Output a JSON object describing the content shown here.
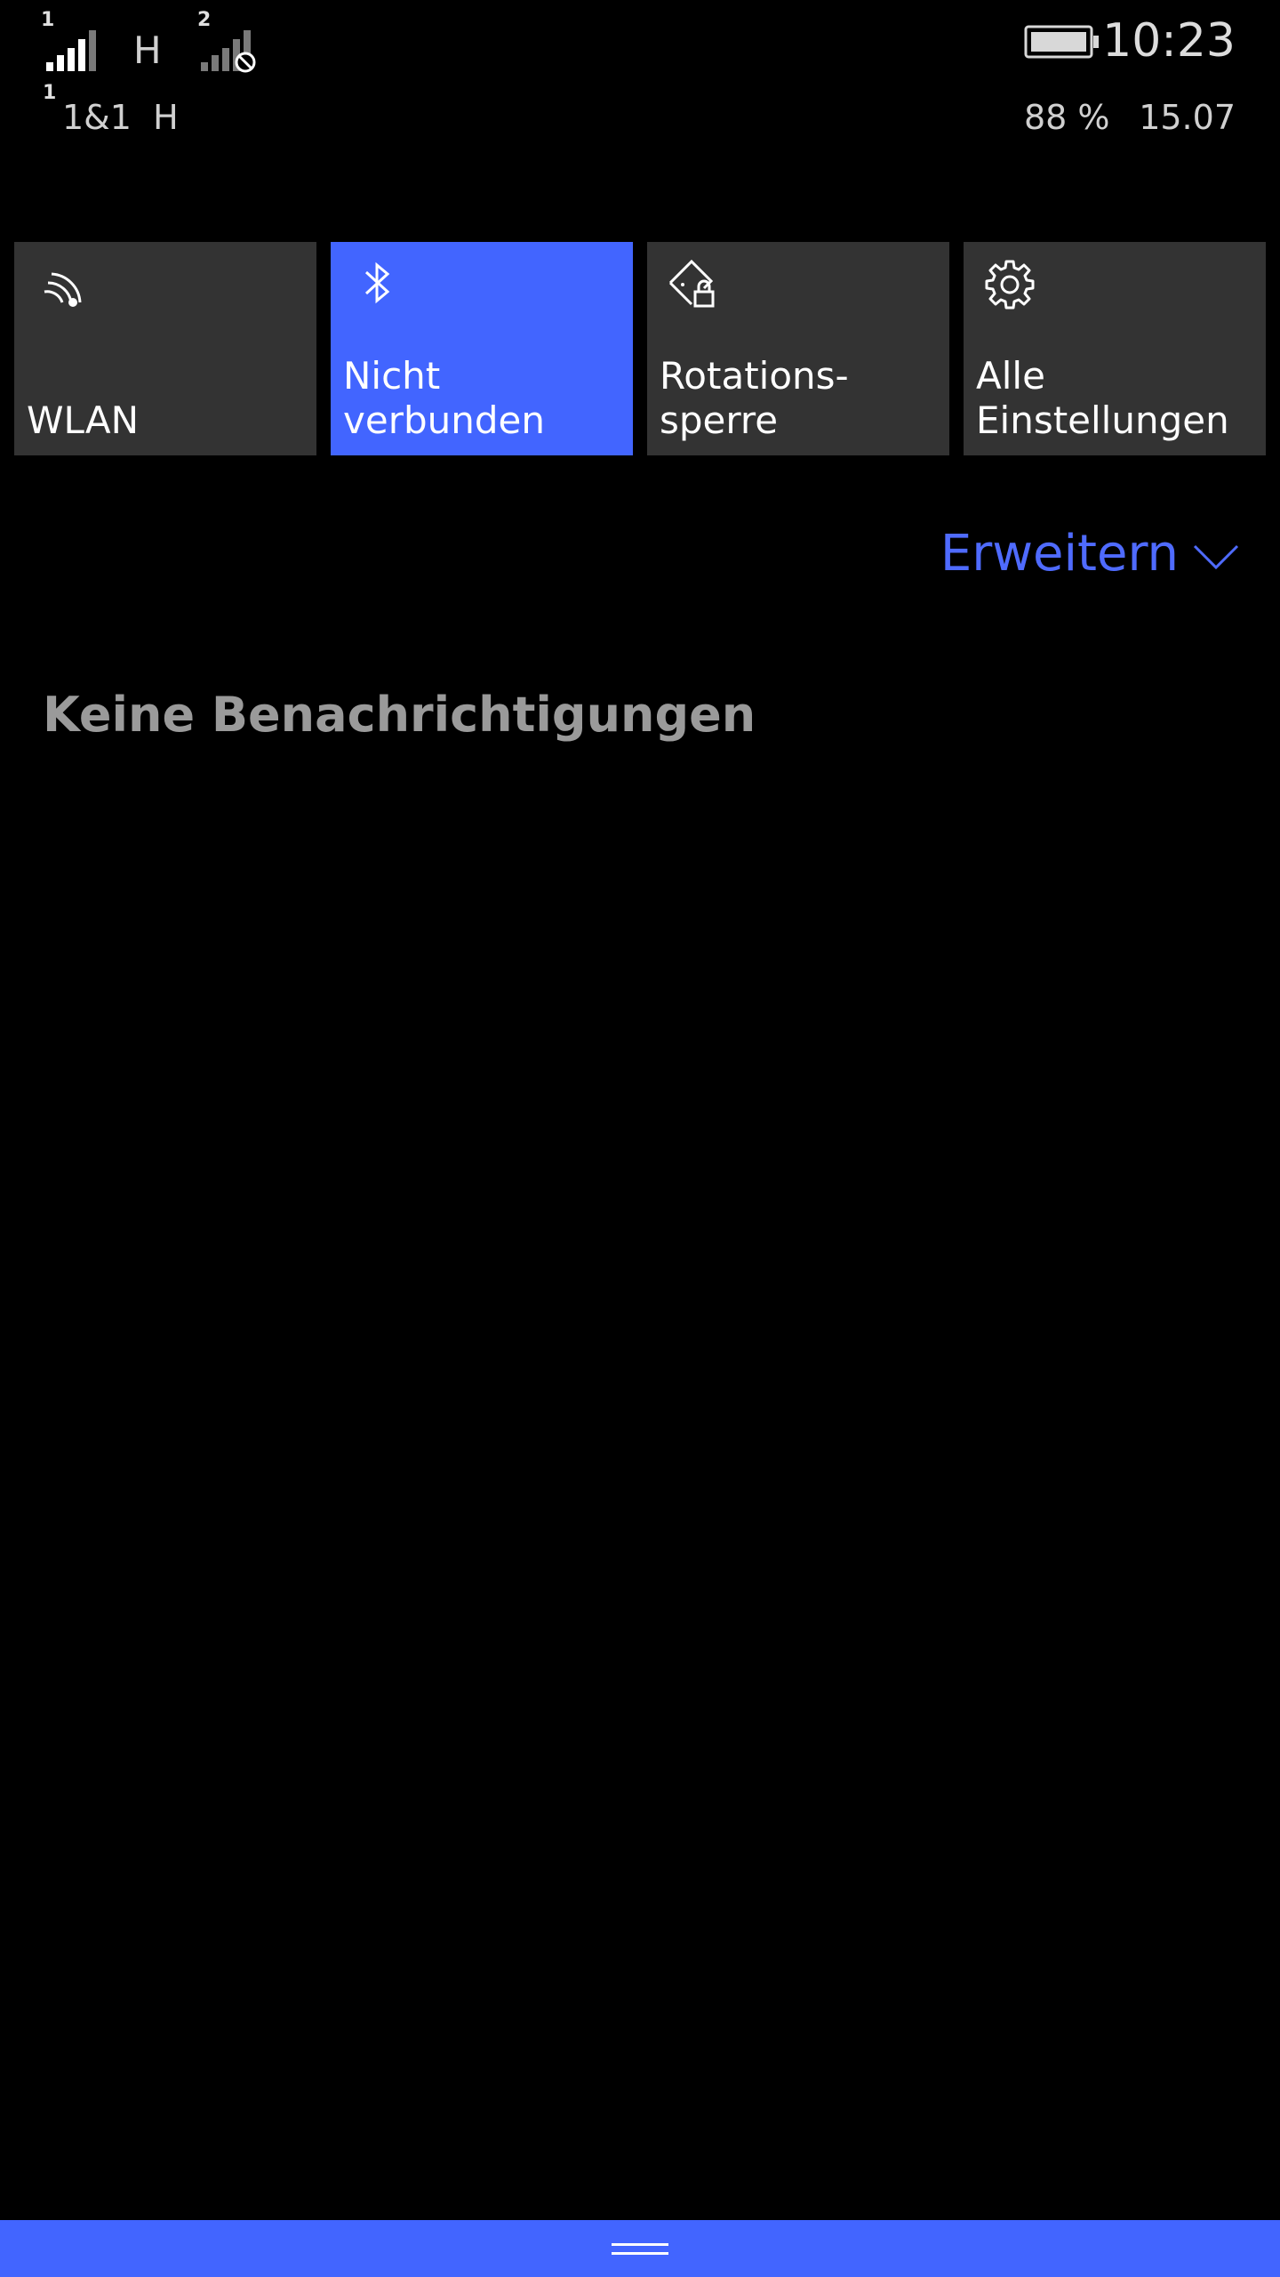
{
  "status_bar": {
    "sim1": {
      "index": "1",
      "network": "H"
    },
    "sim2": {
      "index": "2"
    },
    "carrier": {
      "index": "1",
      "name": "1&1  H"
    },
    "battery_percent": "88 %",
    "time": "10:23",
    "date": "15.07"
  },
  "quick_actions": [
    {
      "label": "WLAN",
      "icon": "wifi-icon",
      "active": false
    },
    {
      "label": "Nicht\nverbunden",
      "icon": "bluetooth-icon",
      "active": true
    },
    {
      "label": "Rotations-\nsperre",
      "icon": "rotation-lock-icon",
      "active": false
    },
    {
      "label": "Alle\nEinstellungen",
      "icon": "gear-icon",
      "active": false
    }
  ],
  "expand": {
    "label": "Erweitern",
    "icon": "chevron-down-icon"
  },
  "notifications": {
    "empty_text": "Keine Benachrichtigungen"
  },
  "colors": {
    "accent": "#4265ff",
    "accent_text": "#4f6bff",
    "tile": "#333333",
    "background": "#000000"
  }
}
